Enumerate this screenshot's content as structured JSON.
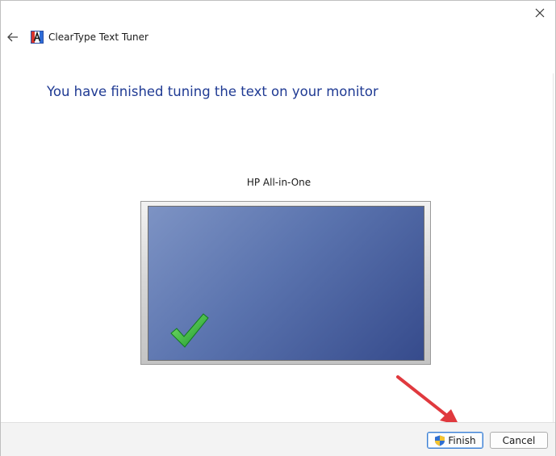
{
  "window": {
    "title": "ClearType Text Tuner",
    "close_symbol": "✕",
    "back_symbol": "←"
  },
  "main": {
    "heading": "You have finished tuning the text on your monitor",
    "monitor_name": "HP All-in-One"
  },
  "footer": {
    "finish_label": "Finish",
    "cancel_label": "Cancel"
  },
  "icons": {
    "app": "cleartype-icon",
    "back": "back-arrow-icon",
    "close": "close-icon",
    "check": "green-checkmark-icon",
    "shield": "uac-shield-icon",
    "pointer": "red-arrow-annotation-icon"
  },
  "colors": {
    "heading": "#1f3a93",
    "screen_light": "#7d93c4",
    "screen_dark": "#364b8c",
    "check_green": "#2fb52f",
    "annotation_red": "#e0393e"
  }
}
